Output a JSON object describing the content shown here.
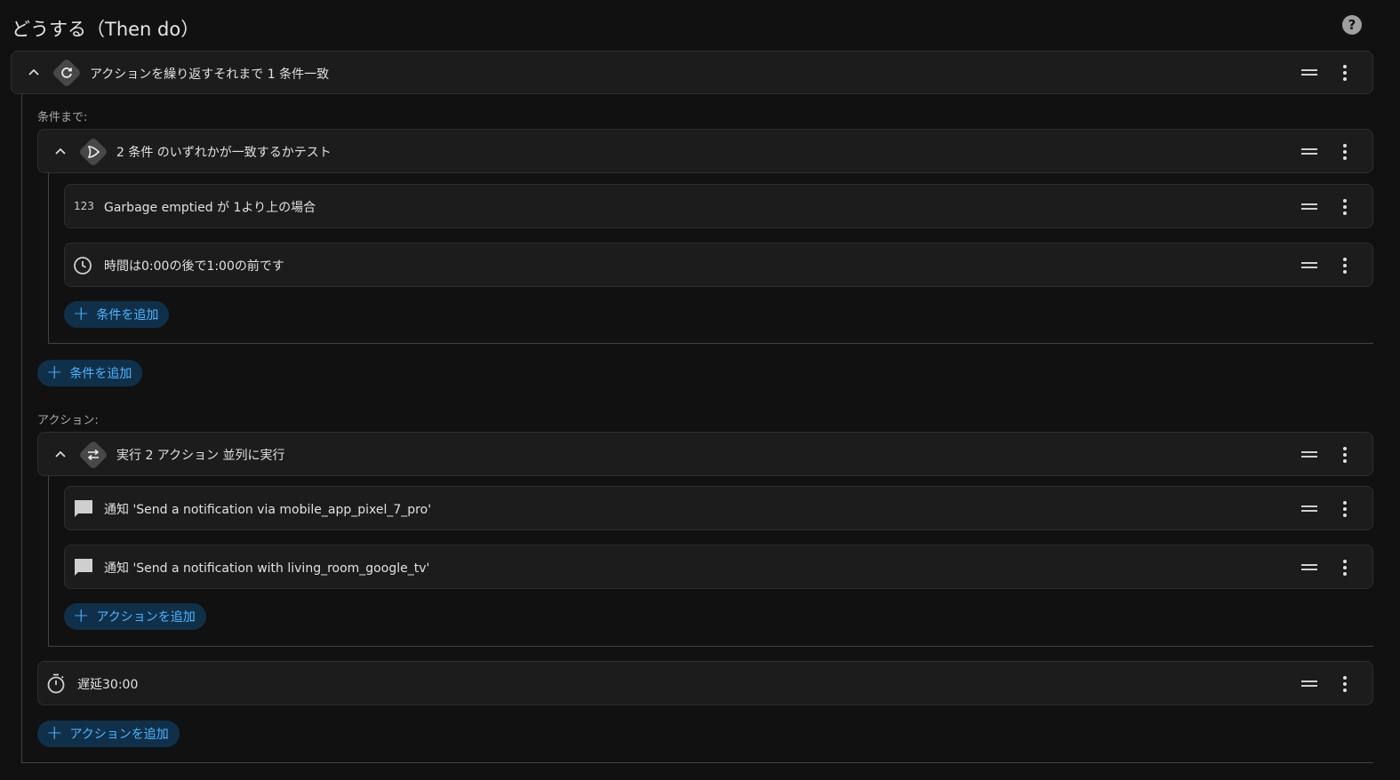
{
  "header": {
    "title": "どうする（Then do）",
    "help_icon": "help-icon"
  },
  "repeat": {
    "summary": "アクションを繰り返すそれまで 1 条件一致",
    "icon": "refresh-icon",
    "until_label": "条件まで:",
    "actions_label": "アクション:"
  },
  "or_condition": {
    "summary": "2 条件 のいずれかが一致するかテスト",
    "icon": "logic-or-icon",
    "conditions": [
      {
        "icon": "numeric-icon",
        "icon_text": "123",
        "text": "Garbage emptied が 1より上の場合"
      },
      {
        "icon": "clock-icon",
        "text": "時間は0:00の後で1:00の前です"
      }
    ],
    "add_condition_label": "条件を追加"
  },
  "add_condition_outer_label": "条件を追加",
  "parallel": {
    "summary": "実行 2 アクション 並列に実行",
    "icon": "parallel-arrows-icon",
    "actions": [
      {
        "icon": "message-icon",
        "text": "通知 'Send a notification via mobile_app_pixel_7_pro'"
      },
      {
        "icon": "message-icon",
        "text": "通知 'Send a notification with living_room_google_tv'"
      }
    ],
    "add_action_label": "アクションを追加"
  },
  "delay": {
    "icon": "timer-icon",
    "text": "遅延30:00"
  },
  "add_action_outer_label": "アクションを追加",
  "colors": {
    "background": "#111111",
    "card": "#1c1c1c",
    "accent": "#4fb3ff",
    "accent_bg": "#10304a"
  }
}
